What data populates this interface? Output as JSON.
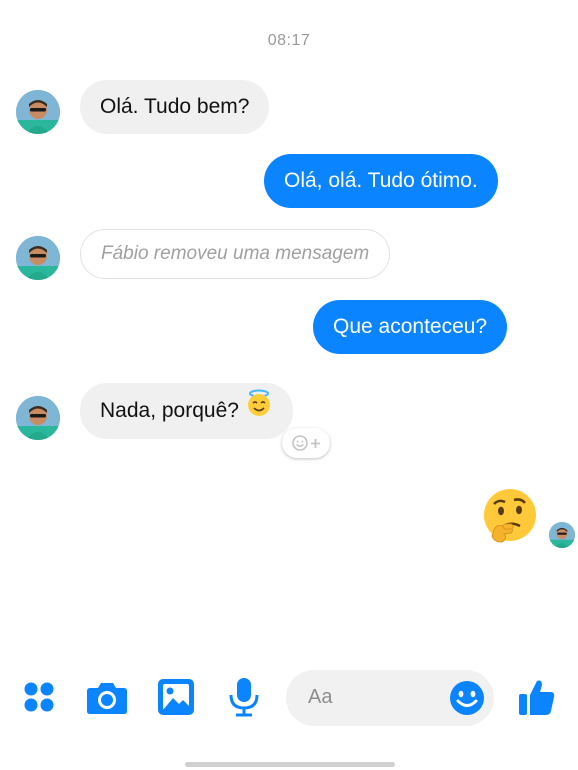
{
  "chat": {
    "timestamp": "08:17",
    "messages": [
      {
        "direction": "in",
        "text": "Olá. Tudo bem?"
      },
      {
        "direction": "out",
        "text": "Olá, olá. Tudo ótimo."
      },
      {
        "direction": "in",
        "type": "removed",
        "text": "Fábio removeu uma mensagem"
      },
      {
        "direction": "out",
        "text": "Que aconteceu?"
      },
      {
        "direction": "in",
        "text": "Nada, porquê?",
        "emoji": "smiling-face-with-halo"
      },
      {
        "direction": "out",
        "type": "emoji",
        "emoji": "thinking-face"
      }
    ]
  },
  "composer": {
    "placeholder": "Aa",
    "icons": [
      "apps-grid-icon",
      "camera-icon",
      "image-icon",
      "microphone-icon",
      "emoji-icon",
      "thumbs-up-icon"
    ]
  },
  "colors": {
    "accent": "#0b84ff",
    "incoming_bubble": "#f0f0f0",
    "timestamp": "#9a9a9a"
  }
}
